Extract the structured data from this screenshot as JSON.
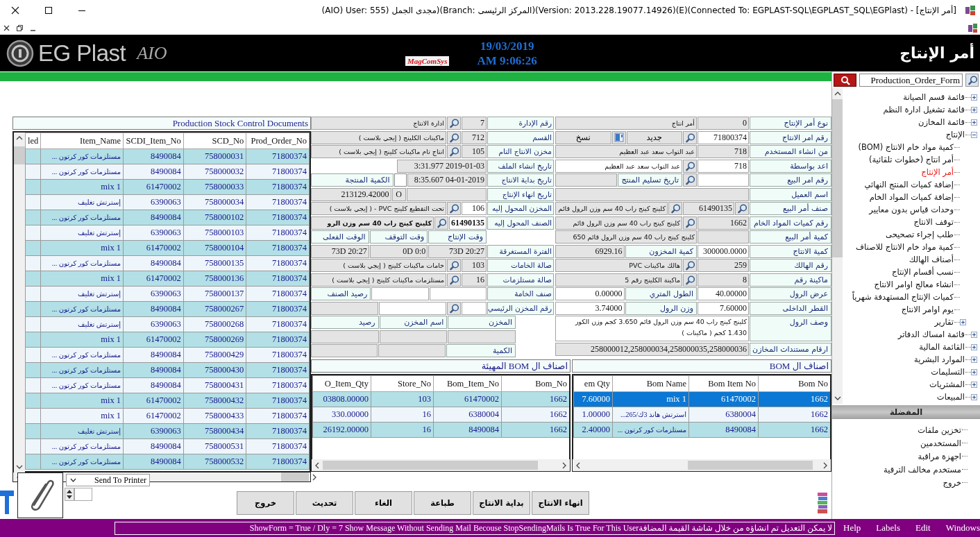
{
  "window": {
    "title": "(AIO) User: 555) مجدى الجمل)(Branch: المركز الرئيسى)(Version: 2013.228.19077.14926)(E)(Connected To: EGPLAST-SQL\\EGPLAST_SQL\\EGPlast) - [أمر الإنتاج]"
  },
  "header": {
    "app_name": "EG Plast",
    "edition": "AIO",
    "vendor": "MagComSys",
    "date": "19/03/2019",
    "time": "AM 9:06:26",
    "form_title": "أمر الإنتاج"
  },
  "sidebar": {
    "search": {
      "value": "Production_Order_Form"
    },
    "tree": [
      {
        "label": "قائمة قسم الصيانة",
        "expanded": false,
        "selected": false
      },
      {
        "label": "قائمة تشغيل ادارة النظم",
        "expanded": false,
        "selected": false
      },
      {
        "label": "قائمة المخازن",
        "expanded": false,
        "selected": false
      },
      {
        "label": "الإنتاج",
        "expanded": true,
        "selected": false,
        "children": [
          {
            "label": "كمية مواد خام الانتاج (BOM)",
            "selected": false
          },
          {
            "label": "أمر انتاج (خطوات تلقائية)",
            "selected": false
          },
          {
            "label": "أمر الإنتاج",
            "selected": true
          },
          {
            "label": "إضافة كميات المنتج النهائي",
            "selected": false
          },
          {
            "label": "إضافة كميات المواد الخام",
            "selected": false
          },
          {
            "label": "وحدات قياس بدون معايير",
            "selected": false
          },
          {
            "label": "توقف الانتاج",
            "selected": false
          },
          {
            "label": "طلب إجراء تصحيحى",
            "selected": false
          },
          {
            "label": "كمية مواد خام الانتاج للاصناف",
            "selected": false
          },
          {
            "label": "أصناف الهالك",
            "selected": false
          },
          {
            "label": "نسب أقسام الإنتاج",
            "selected": false
          },
          {
            "label": "انشاء معالج اوامر الانتاج",
            "selected": false
          },
          {
            "label": "كميات الإنتاج المستهدفة شهرياً",
            "selected": false
          },
          {
            "label": "يوم اوامر الانتاج",
            "selected": false
          },
          {
            "label": "تقارير",
            "expanded": false,
            "selected": false
          }
        ]
      },
      {
        "label": "قائمة امساك الدفاتر",
        "expanded": false,
        "selected": false
      },
      {
        "label": "القائمة المالية",
        "expanded": false,
        "selected": false
      },
      {
        "label": "الموارد البشرية",
        "expanded": false,
        "selected": false
      },
      {
        "label": "التسليمات",
        "expanded": false,
        "selected": false
      },
      {
        "label": "المشتريات",
        "expanded": false,
        "selected": false
      },
      {
        "label": "المبيعات",
        "expanded": false,
        "selected": false
      }
    ],
    "favorites_title": "المفضلة",
    "favorites": [
      "تخزين ملفات",
      "المستخدمين",
      "اجهزة مراقبة",
      "مستخدم مخالف الترقية",
      "خروج"
    ]
  },
  "stock_documents": {
    "title": "Production Stock Control Documents",
    "columns": [
      "Prod_Order_No",
      "SCD_No",
      "SCDI_Item_No",
      "Item_Name",
      "led"
    ],
    "rows": [
      [
        "71800374",
        "758000031",
        "8490084",
        "مستلزمات كور كرتون ..."
      ],
      [
        "71800374",
        "758000032",
        "8490084",
        "مستلزمات كور كرتون ..."
      ],
      [
        "71800374",
        "758000033",
        "61470002",
        "mix 1"
      ],
      [
        "71800374",
        "758000034",
        "6390063",
        "إسترتش تغليف"
      ],
      [
        "71800374",
        "758000102",
        "8490084",
        "مستلزمات كور كرتون ..."
      ],
      [
        "71800374",
        "758000103",
        "6390063",
        "إسترتش تغليف"
      ],
      [
        "71800374",
        "758000104",
        "61470002",
        "mix 1"
      ],
      [
        "71800374",
        "758000135",
        "8490084",
        "مستلزمات كور كرتون ..."
      ],
      [
        "71800374",
        "758000136",
        "61470002",
        "mix 1"
      ],
      [
        "71800374",
        "758000137",
        "6390063",
        "إسترتش تغليف"
      ],
      [
        "71800374",
        "758000267",
        "8490084",
        "مستلزمات كور كرتون ..."
      ],
      [
        "71800374",
        "758000268",
        "6390063",
        "إسترتش تغليف"
      ],
      [
        "71800374",
        "758000269",
        "61470002",
        "mix 1"
      ],
      [
        "71800374",
        "758000429",
        "8490084",
        "مستلزمات كور كرتون ..."
      ],
      [
        "71800374",
        "758000430",
        "8490084",
        "مستلزمات كور كرتون ..."
      ],
      [
        "71800374",
        "758000431",
        "8490084",
        "مستلزمات كور كرتون ..."
      ],
      [
        "71800374",
        "758000432",
        "61470002",
        "mix 1"
      ],
      [
        "71800374",
        "758000433",
        "61470002",
        "mix 1"
      ],
      [
        "71800374",
        "758000434",
        "6390063",
        "إسترتش تغليف"
      ],
      [
        "71800374",
        "758000531",
        "8490084",
        "مستلزمات كور كرتون ..."
      ],
      [
        "71800374",
        "758000532",
        "8490084",
        "مستلزمات كور كرتون ..."
      ]
    ]
  },
  "form": {
    "right": [
      {
        "cells": [
          {
            "kind": "label",
            "text": "نوع أمر الإنتاج"
          },
          {
            "kind": "code",
            "value": "0",
            "disabled": true
          },
          {
            "kind": "field",
            "value": "أمر انتاج",
            "disabled": true
          }
        ]
      },
      {
        "cells": [
          {
            "kind": "label",
            "text": "رقم امر الانتاج"
          },
          {
            "kind": "code",
            "value": "71800374",
            "disabled": false
          },
          {
            "kind": "search"
          },
          {
            "kind": "button",
            "text": "جديد"
          },
          {
            "kind": "tool"
          },
          {
            "kind": "button",
            "text": "نسخ"
          }
        ]
      },
      {
        "cells": [
          {
            "kind": "label",
            "text": "من انشاء المستخدم"
          },
          {
            "kind": "code",
            "value": "718",
            "disabled": true
          },
          {
            "kind": "field",
            "value": "عبد التواب سعد عبد العظيم",
            "disabled": true
          }
        ]
      },
      {
        "cells": [
          {
            "kind": "label",
            "text": "اعد بواسطة"
          },
          {
            "kind": "code",
            "value": "718",
            "disabled": false
          },
          {
            "kind": "search"
          },
          {
            "kind": "field",
            "value": "عبد التواب سعد عبد العظيم",
            "disabled": false
          }
        ]
      },
      {
        "cells": [
          {
            "kind": "label",
            "text": "رقم امر البيع"
          },
          {
            "kind": "code",
            "disabled": false
          },
          {
            "kind": "search"
          },
          {
            "kind": "sublabel",
            "text": "تاريخ تسليم المنتج"
          },
          {
            "kind": "field",
            "disabled": true
          }
        ]
      },
      {
        "cells": [
          {
            "kind": "label",
            "text": "اسم العميل"
          },
          {
            "kind": "field",
            "disabled": true
          }
        ]
      },
      {
        "cells": [
          {
            "kind": "label",
            "text": "صنف أمر البيع"
          },
          {
            "kind": "search"
          },
          {
            "kind": "code",
            "value": "61490135",
            "disabled": true
          },
          {
            "kind": "search"
          },
          {
            "kind": "field",
            "value": "كلينج كينج راب 40 سم وزن الرول قائم",
            "disabled": true
          }
        ]
      },
      {
        "cells": [
          {
            "kind": "label",
            "text": "رقم كميات المواد الخام"
          },
          {
            "kind": "code",
            "value": "1662",
            "disabled": true
          },
          {
            "kind": "search"
          },
          {
            "kind": "field",
            "value": "كلينج كينج راب 40 سم وزن الرول قائم",
            "disabled": true
          }
        ]
      },
      {
        "cells": [
          {
            "kind": "label",
            "text": "كمية أمر البيع"
          },
          {
            "kind": "code",
            "disabled": true
          },
          {
            "kind": "field",
            "value": "كلينج كينج راب 40 سم وزن الرول قائم 650",
            "disabled": true
          }
        ]
      },
      {
        "cells": [
          {
            "kind": "label",
            "text": "كمية الانتاج"
          },
          {
            "kind": "code",
            "value": "300000.0000",
            "disabled": false
          },
          {
            "kind": "sublabel",
            "text": "كمية المخزون"
          },
          {
            "kind": "field",
            "value": "6929.16",
            "disabled": true
          }
        ]
      },
      {
        "cells": [
          {
            "kind": "label",
            "text": "رقم الهالك"
          },
          {
            "kind": "code",
            "value": "259",
            "disabled": true
          },
          {
            "kind": "search"
          },
          {
            "kind": "field",
            "value": "هالك ماكينات PVC",
            "disabled": true
          }
        ]
      },
      {
        "cells": [
          {
            "kind": "label",
            "text": "ماكينة رقم"
          },
          {
            "kind": "code",
            "value": "8",
            "disabled": true
          },
          {
            "kind": "search"
          },
          {
            "kind": "field",
            "value": "ماكينة الكلينج رقم 5",
            "disabled": true
          }
        ]
      },
      {
        "cells": [
          {
            "kind": "label",
            "text": "عرض الرول"
          },
          {
            "kind": "code",
            "value": "40.00000",
            "disabled": false
          },
          {
            "kind": "sublabel",
            "text": "الطول المتري"
          },
          {
            "kind": "field",
            "value": "0.00000",
            "disabled": false
          }
        ]
      },
      {
        "cells": [
          {
            "kind": "label",
            "text": "القطر الداخلى"
          },
          {
            "kind": "code",
            "value": "7.60000",
            "disabled": false
          },
          {
            "kind": "sublabel",
            "text": "وزن الرول"
          },
          {
            "kind": "field",
            "value": "3.74000",
            "disabled": false
          }
        ]
      },
      {
        "cells": [
          {
            "kind": "label",
            "text": "وصف الرول"
          },
          {
            "kind": "textarea",
            "value": "كلينج كينج راب 40 سم وزن الرول قائم 3.650 كجم وزن الكور 1.430 كجم ( ماكينات )",
            "disabled": false
          }
        ]
      },
      {
        "cells": [
          {
            "kind": "label",
            "text": "ارقام مستندات المخازن"
          },
          {
            "kind": "field",
            "value": "258000012,258000034,258000035,258000036",
            "disabled": true
          }
        ]
      }
    ],
    "left": [
      {
        "cells": [
          {
            "kind": "label",
            "text": "رقم الإدارة"
          },
          {
            "kind": "code",
            "value": "7",
            "disabled": true
          },
          {
            "kind": "search"
          },
          {
            "kind": "field",
            "value": "ادارة الانتاج",
            "disabled": true
          }
        ]
      },
      {
        "cells": [
          {
            "kind": "label",
            "text": "القسم"
          },
          {
            "kind": "code",
            "value": "712",
            "disabled": true
          },
          {
            "kind": "search"
          },
          {
            "kind": "field",
            "value": "ماكينات الكلينج ( إيجي بلاست )",
            "disabled": true
          }
        ]
      },
      {
        "cells": [
          {
            "kind": "label",
            "text": "مخزن الانتاج التام"
          },
          {
            "kind": "code",
            "value": "105",
            "disabled": true
          },
          {
            "kind": "search"
          },
          {
            "kind": "field",
            "value": "انتاج تام ماكينات كلينج ( إيجي بلاست )",
            "disabled": true
          }
        ]
      },
      {
        "cells": [
          {
            "kind": "label",
            "text": "تاريخ انشاء الملف"
          },
          {
            "kind": "field",
            "value": "3:31.977 2019-01-03",
            "disabled": true
          },
          {
            "kind": "space"
          }
        ]
      },
      {
        "cells": [
          {
            "kind": "label",
            "text": "تاريخ بداية الانتاج"
          },
          {
            "kind": "field",
            "value": "8:35.607 04-01-2019",
            "disabled": true
          },
          {
            "kind": "check",
            "checked": false
          },
          {
            "kind": "sublabel",
            "text": "الكمية المنتجة"
          }
        ]
      },
      {
        "cells": [
          {
            "kind": "label",
            "text": "تاريخ انهاء الإنتاج"
          },
          {
            "kind": "field",
            "disabled": true
          },
          {
            "kind": "tiny",
            "value": "O",
            "disabled": true
          },
          {
            "kind": "field",
            "value": "213129.42000",
            "disabled": true
          }
        ]
      },
      {
        "cells": [
          {
            "kind": "label",
            "text": "المخزن المحول إليه"
          },
          {
            "kind": "code",
            "value": "106",
            "disabled": false
          },
          {
            "kind": "search"
          },
          {
            "kind": "field",
            "value": "تحت التقطيع كلينج PVC - ( إيجي بلاست )",
            "disabled": true
          }
        ]
      },
      {
        "cells": [
          {
            "kind": "label",
            "text": "الصنف المحول إليه"
          },
          {
            "kind": "strong",
            "value": "61490135",
            "disabled": false
          },
          {
            "kind": "search"
          },
          {
            "kind": "strong",
            "value": "كلينج كينج راب 40 سم وزن الرو",
            "disabled": true
          }
        ]
      },
      {
        "cells": [
          {
            "kind": "indent"
          },
          {
            "kind": "sublabel",
            "text": "وقت الإنتاج"
          },
          {
            "kind": "sublabel",
            "text": "وقت التوقف"
          },
          {
            "kind": "sublabel",
            "text": "الوقت الفعلى"
          }
        ]
      },
      {
        "cells": [
          {
            "kind": "label",
            "text": "الفترة المستغرقة"
          },
          {
            "kind": "field",
            "value": "73D 20:27",
            "disabled": true
          },
          {
            "kind": "field",
            "value": "0D 0:0",
            "disabled": true
          },
          {
            "kind": "field",
            "value": "73D 20:27",
            "disabled": true
          }
        ]
      },
      {
        "cells": [
          {
            "kind": "label",
            "text": "صالة الخامات"
          },
          {
            "kind": "code",
            "value": "103",
            "disabled": true
          },
          {
            "kind": "search"
          },
          {
            "kind": "field",
            "value": "خامات ماكينات كلينج ( إيجي بلاست )",
            "disabled": true
          }
        ]
      },
      {
        "cells": [
          {
            "kind": "label",
            "text": "صالة مستلزمات"
          },
          {
            "kind": "code",
            "value": "16",
            "disabled": true
          },
          {
            "kind": "search"
          },
          {
            "kind": "field",
            "value": "مستلزمات ماكينات كلينج ( إيجي بلاست )",
            "disabled": true
          }
        ]
      },
      {
        "cells": [
          {
            "kind": "label",
            "text": "صنف الخامة"
          },
          {
            "kind": "field",
            "disabled": false
          },
          {
            "kind": "field",
            "disabled": false
          },
          {
            "kind": "sublabel",
            "text": "رصيد الصنف"
          }
        ]
      },
      {
        "cells": [
          {
            "kind": "label",
            "text": "رقم المخزن الرئيسي"
          },
          {
            "kind": "code",
            "disabled": false
          },
          {
            "kind": "search"
          },
          {
            "kind": "field",
            "disabled": false
          },
          {
            "kind": "field",
            "disabled": true
          }
        ]
      },
      {
        "cells": [
          {
            "kind": "gap"
          },
          {
            "kind": "sublabel",
            "text": "المخزن"
          },
          {
            "kind": "sublabel",
            "text": "اسم المخزن"
          },
          {
            "kind": "sublabel",
            "text": "رصيد"
          }
        ]
      },
      {
        "cells": [
          {
            "kind": "gap"
          },
          {
            "kind": "field",
            "disabled": true
          },
          {
            "kind": "field",
            "disabled": true
          },
          {
            "kind": "field",
            "disabled": true
          }
        ]
      },
      {
        "cells": [
          {
            "kind": "gap"
          },
          {
            "kind": "sublabel",
            "text": "الكمية"
          },
          {
            "kind": "field",
            "disabled": true
          },
          {
            "kind": "field",
            "disabled": true
          }
        ]
      }
    ]
  },
  "bom_items": {
    "title": "اصناف ال BOM",
    "columns": [
      "Bom No",
      "Bom Item No",
      "Bom Name",
      "em Qty"
    ],
    "rows": [
      {
        "cells": [
          "1662",
          "61470002",
          "mix 1",
          "7.60000"
        ],
        "selected": true
      },
      {
        "cells": [
          "1662",
          "6380004",
          "استرتش هاند 3ك/265...",
          "1.00000"
        ],
        "selected": false
      },
      {
        "cells": [
          "1662",
          "8490084",
          "مستلزمات كور كرتون ...",
          "2.40000"
        ],
        "selected": false
      }
    ]
  },
  "prepared_bom_items": {
    "title": "اصناف ال BOM المهيئة",
    "columns": [
      "Bom_No",
      "Bom_Item_No",
      "Store_No",
      "O_Item_Qty"
    ],
    "rows": [
      {
        "cells": [
          "1662",
          "61470002",
          "103",
          "03808.00000"
        ],
        "selected": false
      },
      {
        "cells": [
          "1662",
          "6380004",
          "16",
          "330.00000"
        ],
        "selected": false
      },
      {
        "cells": [
          "1662",
          "8490084",
          "16",
          "26192.00000"
        ],
        "selected": false
      }
    ]
  },
  "printer": {
    "value": "Send To Printer"
  },
  "buttons": [
    "انهاء الانتاج",
    "بداية الانتاج",
    "طباعة",
    "الغاء",
    "تحديث",
    "خروج"
  ],
  "status_bar": {
    "message": "لا يمكن التعديل  تم انشاؤه من خلال شاشة  القيمة المضافةShowForm = True / Dly = 7 Show Message Without Sending Mail Becouse StopSendingMails Is True For This User",
    "menu": [
      "Windows",
      "Edit",
      "Labels",
      "Help"
    ]
  }
}
